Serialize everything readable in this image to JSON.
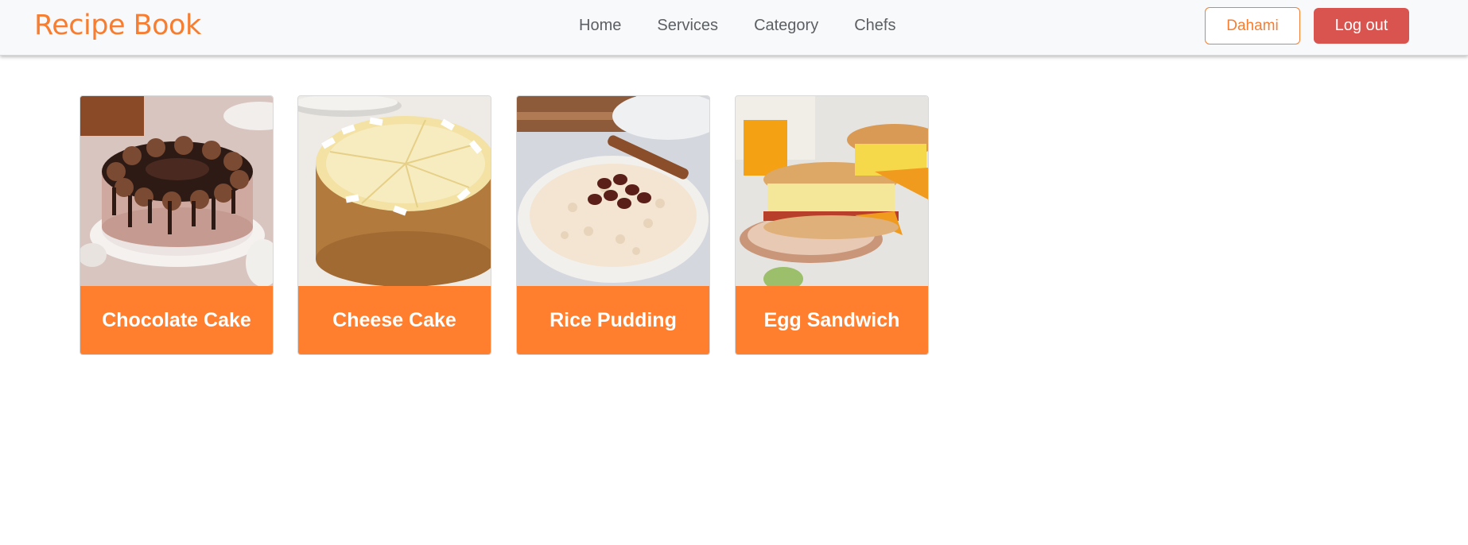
{
  "navbar": {
    "brand": "Recipe Book",
    "links": [
      "Home",
      "Services",
      "Category",
      "Chefs"
    ],
    "user_label": "Dahami",
    "logout_label": "Log out"
  },
  "recipes": [
    {
      "title": "Chocolate Cake",
      "image": "chocolate-cake-photo"
    },
    {
      "title": "Cheese Cake",
      "image": "cheese-cake-photo"
    },
    {
      "title": "Rice Pudding",
      "image": "rice-pudding-photo"
    },
    {
      "title": "Egg Sandwich",
      "image": "egg-sandwich-photo"
    }
  ],
  "colors": {
    "brand": "#f77d30",
    "card_caption": "#ff7f2f",
    "logout": "#d9534f",
    "navbar_bg": "#f8f9fa"
  }
}
